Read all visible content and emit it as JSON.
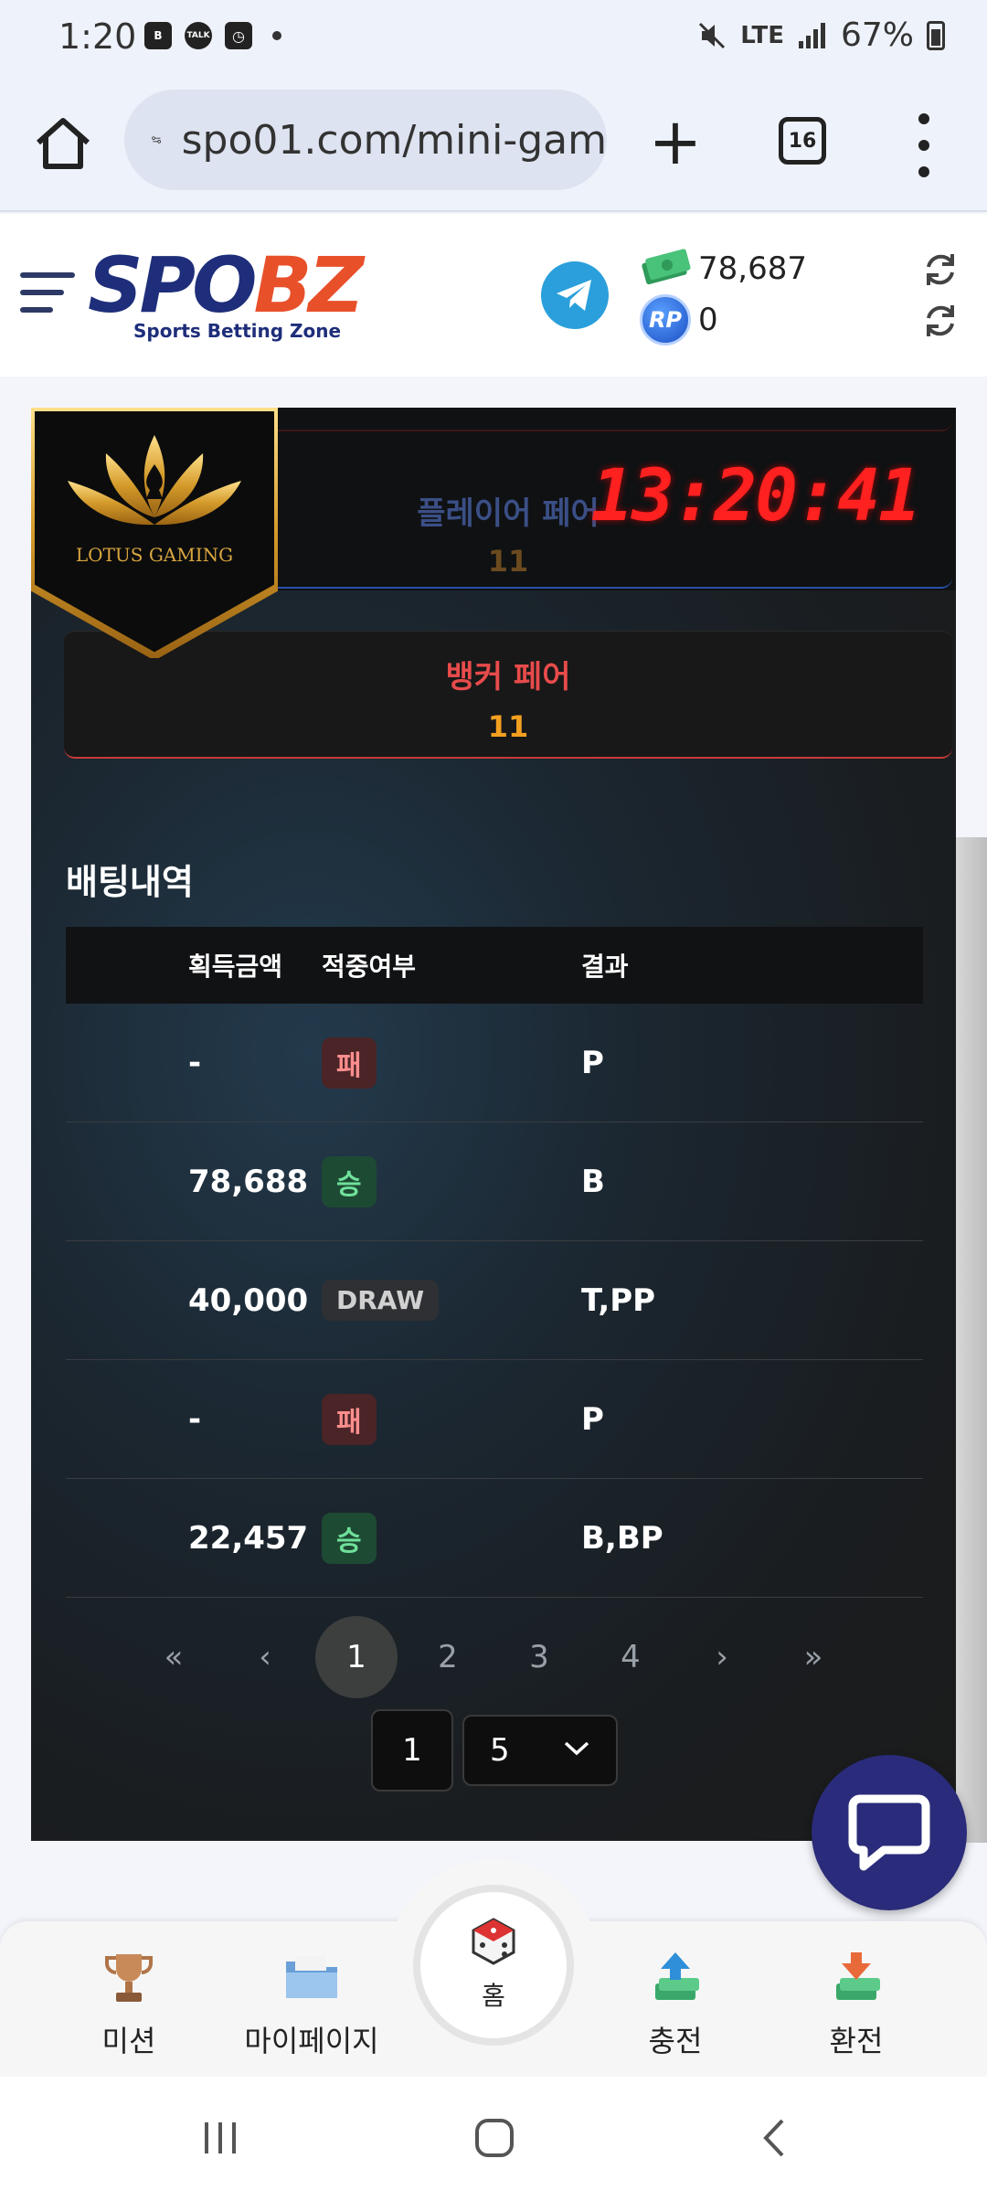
{
  "status_bar": {
    "time": "1:20",
    "icons_left": [
      "b-icon",
      "talk-icon",
      "clock-app-icon",
      "dot"
    ],
    "icon_b": "B",
    "icon_talk": "TALK",
    "network": "LTE",
    "battery": "67%"
  },
  "browser": {
    "url": "spo01.com/mini-gam",
    "tab_count": "16"
  },
  "header": {
    "logo_main_a": "SPO",
    "logo_main_b": "BZ",
    "logo_sub": "Sports Betting Zone",
    "money_value": "78,687",
    "rp_value": "0",
    "rp_label": "RP"
  },
  "game": {
    "clock": "13:20:41",
    "player_pair_label": "플레이어 페어",
    "player_pair_value": "11",
    "banker_pair_label": "뱅커 페어",
    "banker_pair_value": "11",
    "badge_text": "LOTUS GAMING"
  },
  "history": {
    "title": "배팅내역",
    "columns": [
      "획득금액",
      "적중여부",
      "결과"
    ],
    "rows": [
      {
        "amount": "-",
        "status": "패",
        "status_type": "lose",
        "result": "P"
      },
      {
        "amount": "78,688",
        "status": "승",
        "status_type": "win",
        "result": "B"
      },
      {
        "amount": "40,000",
        "status": "DRAW",
        "status_type": "draw",
        "result": "T,PP"
      },
      {
        "amount": "-",
        "status": "패",
        "status_type": "lose",
        "result": "P"
      },
      {
        "amount": "22,457",
        "status": "승",
        "status_type": "win",
        "result": "B,BP"
      }
    ]
  },
  "pagination": {
    "first": "«",
    "prev": "‹",
    "pages": [
      "1",
      "2",
      "3",
      "4"
    ],
    "active_page": "1",
    "next": "›",
    "last": "»",
    "page_input": "1",
    "page_size": "5"
  },
  "bottom_nav": {
    "mission": "미션",
    "mypage": "마이페이지",
    "home": "홈",
    "deposit": "충전",
    "withdraw": "환전"
  },
  "colors": {
    "clock": "#ff2020",
    "banker": "#e84b4b",
    "pair_value": "#f3a020",
    "chat_button": "#2a2b7a"
  }
}
